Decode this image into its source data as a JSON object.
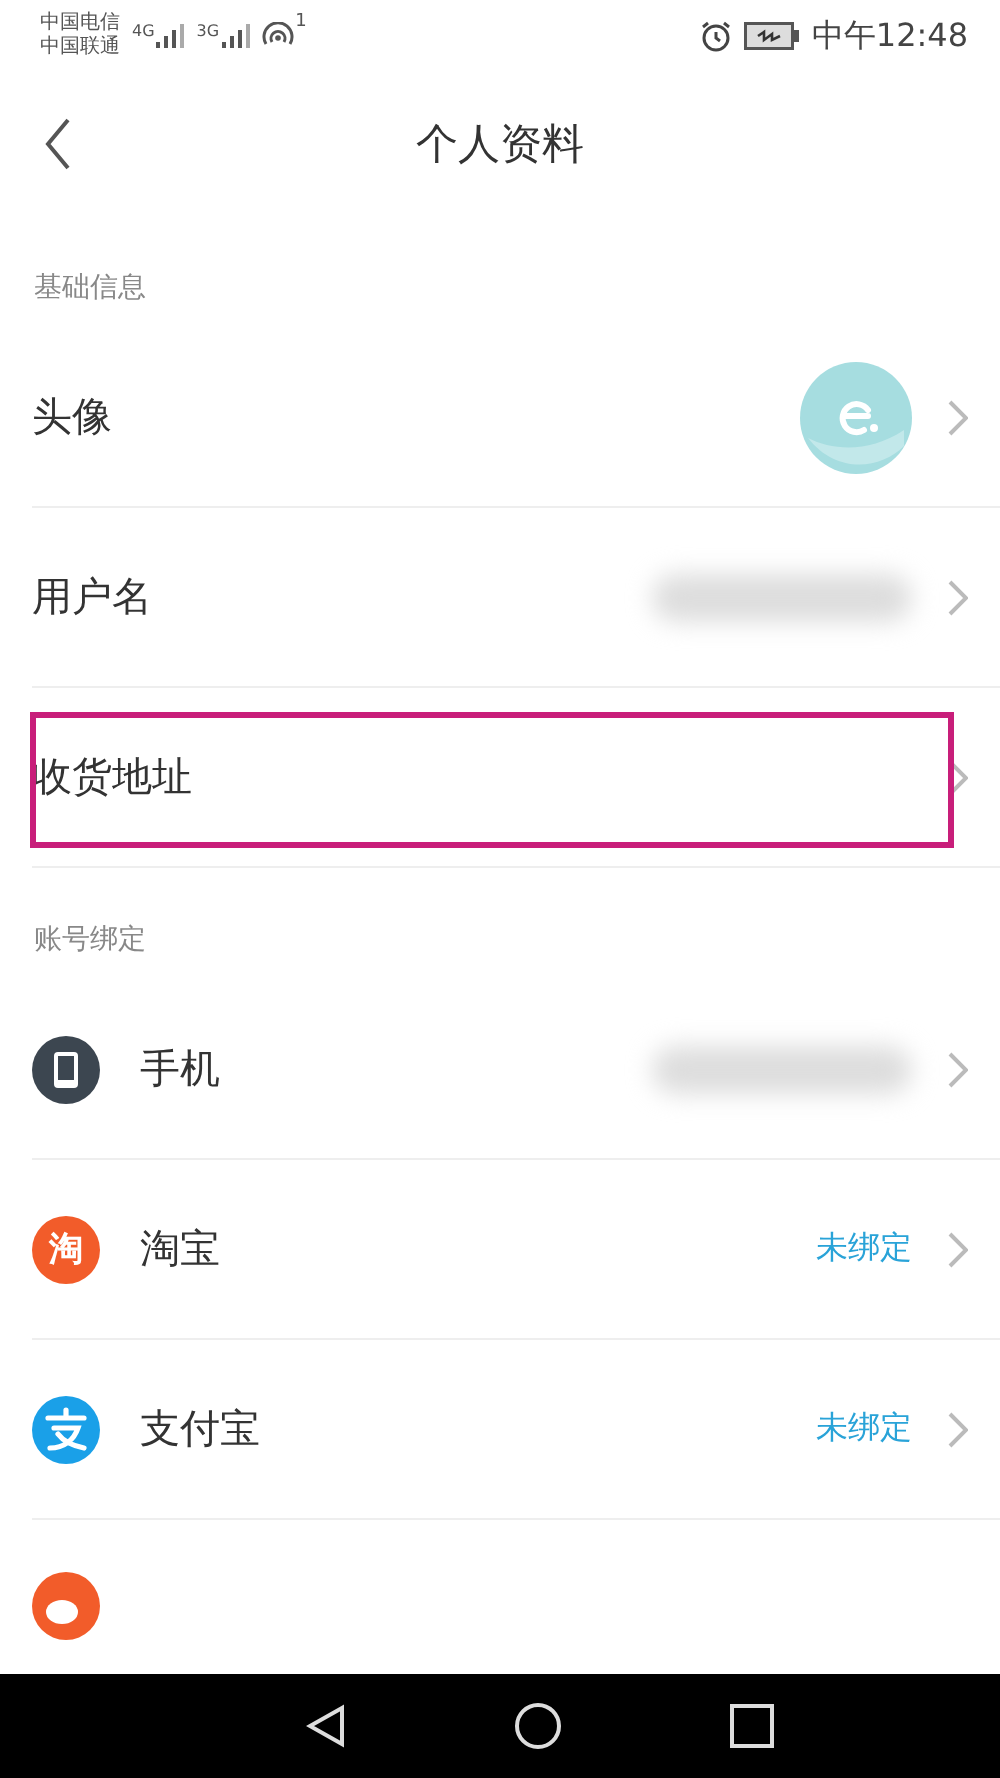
{
  "status_bar": {
    "carriers": [
      "中国电信",
      "中国联通"
    ],
    "network_1": "4G",
    "network_2": "3G",
    "hotspot_count": "1",
    "time": "中午12:48"
  },
  "header": {
    "title": "个人资料"
  },
  "sections": [
    {
      "label": "基础信息",
      "rows": [
        {
          "kind": "avatar",
          "label": "头像",
          "highlighted": false
        },
        {
          "kind": "username",
          "label": "用户名",
          "highlighted": false
        },
        {
          "kind": "address",
          "label": "收货地址",
          "highlighted": true
        }
      ]
    },
    {
      "label": "账号绑定",
      "rows": [
        {
          "kind": "phone",
          "label": "手机",
          "highlighted": false
        },
        {
          "kind": "taobao",
          "icon_text": "淘",
          "label": "淘宝",
          "status": "未绑定",
          "highlighted": false
        },
        {
          "kind": "alipay",
          "label": "支付宝",
          "status": "未绑定",
          "highlighted": false
        },
        {
          "kind": "weibo"
        }
      ]
    }
  ]
}
